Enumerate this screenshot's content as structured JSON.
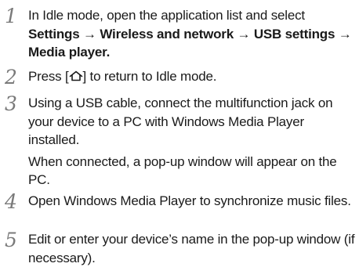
{
  "steps": [
    {
      "number": "1",
      "intro": "In Idle mode, open the application list and select",
      "path": {
        "settings": "Settings",
        "wireless": "Wireless and network",
        "usb": "USB settings",
        "media": "Media player",
        "arrow": "→",
        "end": "."
      }
    },
    {
      "number": "2",
      "before": "Press [",
      "key_icon": "home-key-icon",
      "after": "] to return to Idle mode."
    },
    {
      "number": "3",
      "para1": "Using a USB cable, connect the multifunction jack on your device to a PC with Windows Media Player installed.",
      "para2": "When connected, a pop-up window will appear on the PC."
    },
    {
      "number": "4",
      "text": "Open Windows Media Player to synchronize music files."
    },
    {
      "number": "5",
      "text": "Edit or enter your device’s name in the pop-up window (if necessary)."
    }
  ]
}
